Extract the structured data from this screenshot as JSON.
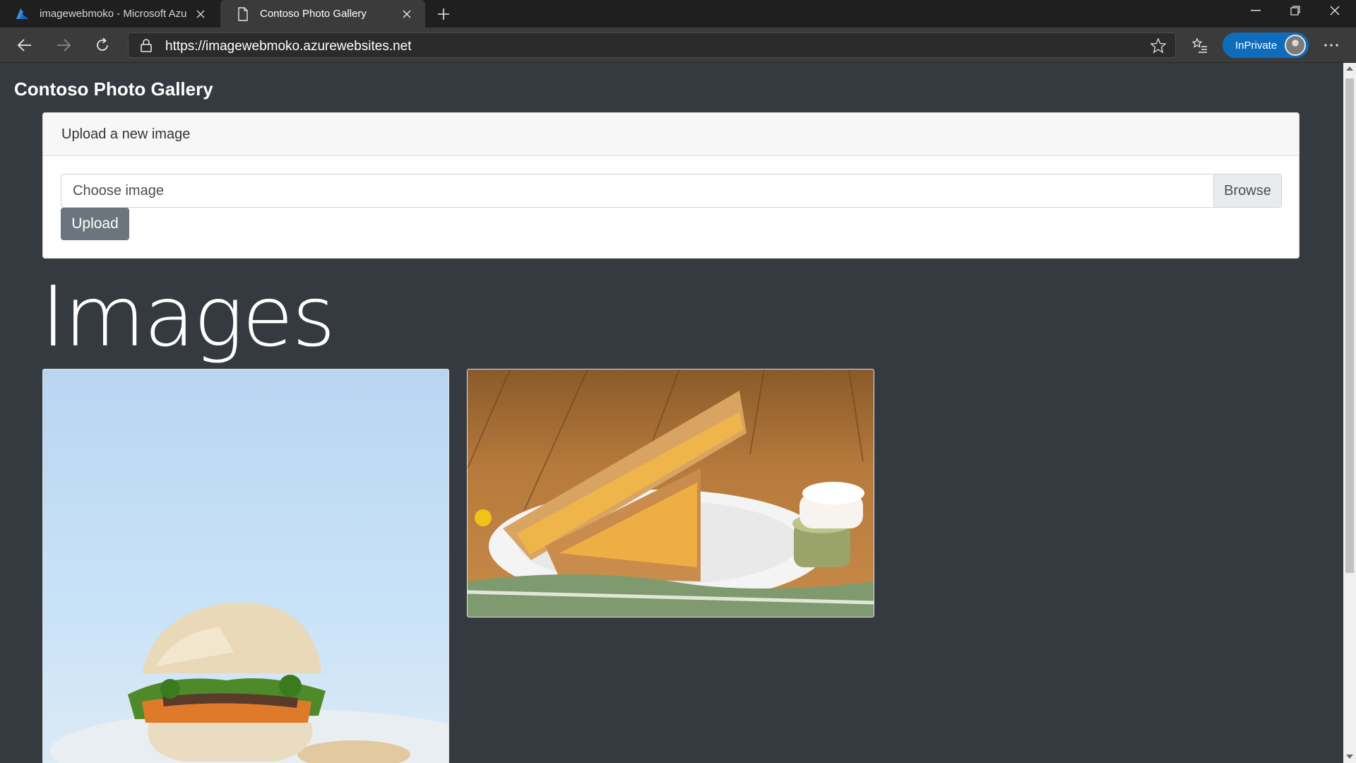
{
  "browser": {
    "tabs": [
      {
        "label": "imagewebmoko - Microsoft Azu",
        "icon": "azure-icon",
        "active": false
      },
      {
        "label": "Contoso Photo Gallery",
        "icon": "page-icon",
        "active": true
      }
    ],
    "url_prefix": "https://",
    "url_host": "imagewebmoko.azurewebsites.net",
    "inprivate_label": "InPrivate"
  },
  "app": {
    "brand": "Contoso Photo Gallery"
  },
  "upload": {
    "header": "Upload a new image",
    "placeholder": "Choose image",
    "browse_label": "Browse",
    "button_label": "Upload"
  },
  "gallery": {
    "title": "Images",
    "images": [
      {
        "description": "sandwich-on-blue-background"
      },
      {
        "description": "grilled-sandwich-on-plate"
      }
    ]
  },
  "colors": {
    "page_bg": "#343a40",
    "accent": "#0f6cbd",
    "upload_button": "#6c757d"
  }
}
